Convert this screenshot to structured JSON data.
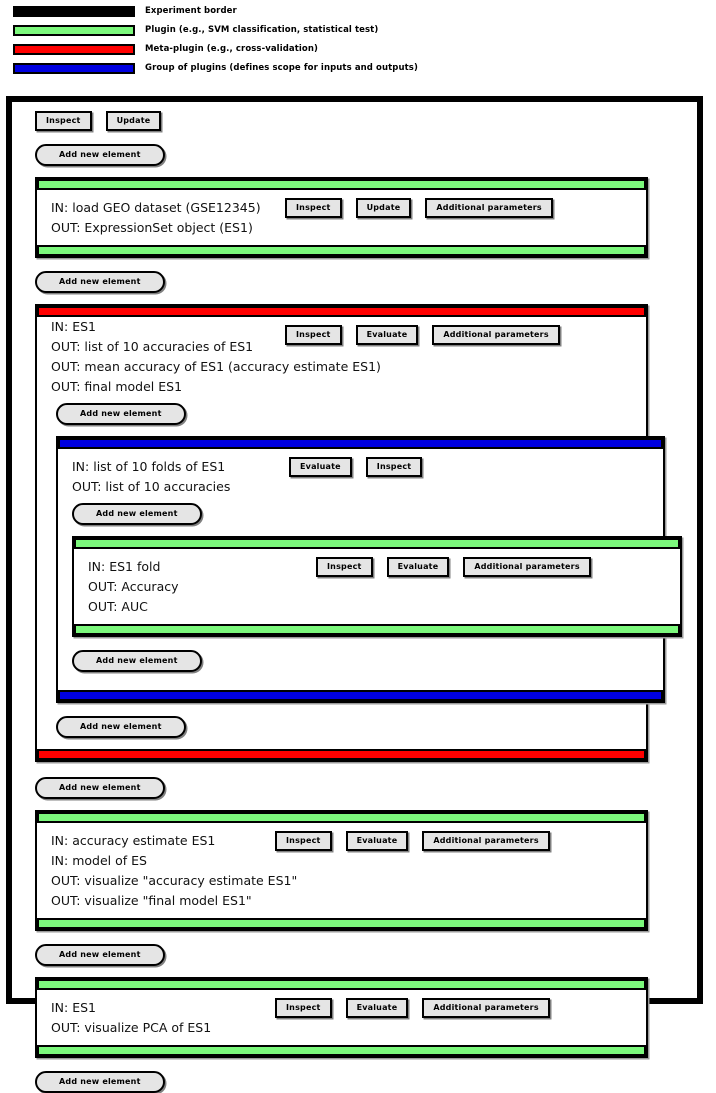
{
  "legend": {
    "items": [
      {
        "swatch_color": "#000000",
        "label": "Experiment border",
        "icon": "legend-swatch-black"
      },
      {
        "swatch_color": "#7CF87C",
        "label": "Plugin (e.g., SVM classification, statistical test)",
        "icon": "legend-swatch-green"
      },
      {
        "swatch_color": "#FF0000",
        "label": "Meta-plugin (e.g., cross-validation)",
        "icon": "legend-swatch-red"
      },
      {
        "swatch_color": "#0000E0",
        "label": "Group of plugins (defines scope for inputs and outputs)",
        "icon": "legend-swatch-blue"
      }
    ]
  },
  "experiment": {
    "toolbar": {
      "inspect": "Inspect",
      "update": "Update"
    },
    "add_new_element": "Add new element",
    "blocks": {
      "load_geo": {
        "type": "plugin",
        "color": "#7CF87C",
        "lines": [
          "IN: load GEO dataset (GSE12345)",
          "OUT: ExpressionSet object (ES1)"
        ],
        "buttons": [
          "Inspect",
          "Update",
          "Additional parameters"
        ]
      },
      "cross_validation": {
        "type": "meta-plugin",
        "color": "#FF0000",
        "lines": [
          "IN: ES1",
          "OUT: list of 10 accuracies of ES1",
          "OUT: mean accuracy of ES1 (accuracy estimate ES1)",
          "OUT: final model ES1"
        ],
        "buttons": [
          "Inspect",
          "Evaluate",
          "Additional parameters"
        ]
      },
      "folds_group": {
        "type": "group",
        "color": "#0000E0",
        "lines": [
          "IN: list of 10 folds of ES1",
          "OUT: list of 10 accuracies"
        ],
        "buttons": [
          "Evaluate",
          "Inspect"
        ]
      },
      "fold_plugin": {
        "type": "plugin",
        "color": "#7CF87C",
        "lines": [
          "IN: ES1 fold",
          "OUT: Accuracy",
          "OUT: AUC"
        ],
        "buttons": [
          "Inspect",
          "Evaluate",
          "Additional parameters"
        ]
      },
      "visualize_accuracy": {
        "type": "plugin",
        "color": "#7CF87C",
        "lines": [
          "IN: accuracy estimate ES1",
          "IN: model of ES",
          "OUT: visualize \"accuracy estimate ES1\"",
          "OUT: visualize \"final model ES1\""
        ],
        "buttons": [
          "Inspect",
          "Evaluate",
          "Additional parameters"
        ]
      },
      "visualize_pca": {
        "type": "plugin",
        "color": "#7CF87C",
        "lines": [
          "IN: ES1",
          "OUT: visualize PCA of ES1"
        ],
        "buttons": [
          "Inspect",
          "Evaluate",
          "Additional parameters"
        ]
      }
    }
  }
}
